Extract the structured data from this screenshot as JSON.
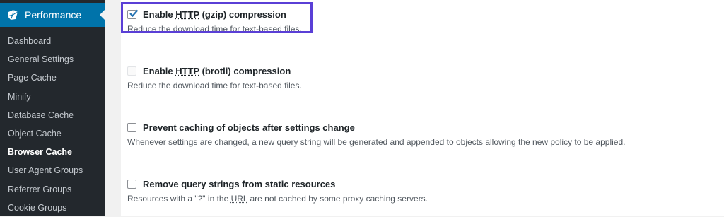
{
  "sidebar": {
    "menu_title": "Performance",
    "icon": "performance-gem-icon",
    "items": [
      {
        "label": "Dashboard"
      },
      {
        "label": "General Settings"
      },
      {
        "label": "Page Cache"
      },
      {
        "label": "Minify"
      },
      {
        "label": "Database Cache"
      },
      {
        "label": "Object Cache"
      },
      {
        "label": "Browser Cache",
        "current": true
      },
      {
        "label": "User Agent Groups"
      },
      {
        "label": "Referrer Groups"
      },
      {
        "label": "Cookie Groups"
      }
    ]
  },
  "options": [
    {
      "label_before": "Enable ",
      "abbr": "HTTP",
      "label_after": " (gzip) compression",
      "description": "Reduce the download time for text-based files.",
      "checked": true,
      "disabled": false
    },
    {
      "label_before": "Enable ",
      "abbr": "HTTP",
      "label_after": " (brotli) compression",
      "description": "Reduce the download time for text-based files.",
      "checked": false,
      "disabled": true
    },
    {
      "label": "Prevent caching of objects after settings change",
      "description": "Whenever settings are changed, a new query string will be generated and appended to objects allowing the new policy to be applied.",
      "checked": false,
      "disabled": false
    },
    {
      "label": "Remove query strings from static resources",
      "description_before": "Resources with a \"?\" in the ",
      "description_abbr": "URL",
      "description_after": " are not cached by some proxy caching servers.",
      "checked": false,
      "disabled": false
    }
  ],
  "colors": {
    "sidebar_bg": "#23282d",
    "active_menu": "#0073aa",
    "highlight_border": "#5a3fd6",
    "checkmark": "#2271b1"
  }
}
